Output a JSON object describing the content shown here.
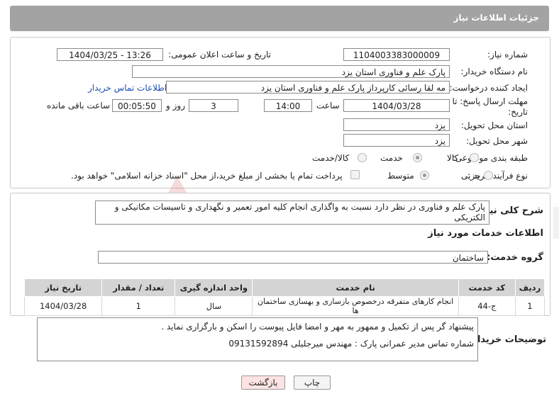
{
  "header": {
    "title": "جزئیات اطلاعات نیاز"
  },
  "form": {
    "need_number_label": "شماره نیاز:",
    "need_number": "1104003383000009",
    "announce_label": "تاریخ و ساعت اعلان عمومی:",
    "announce_value": "1404/03/25 - 13:26",
    "buyer_label": "نام دستگاه خریدار:",
    "buyer_value": "پارک علم و فناوری استان یزد",
    "creator_label": "ایجاد کننده درخواست:",
    "creator_value": "مه لقا رسائی  کارپرداز پارک علم و فناوری استان یزد",
    "contact_link": "اطلاعات تماس خریدار",
    "deadline_label": "مهلت ارسال پاسخ: تا تاریخ:",
    "deadline_date": "1404/03/28",
    "hour_label": "ساعت",
    "deadline_time": "14:00",
    "days_value": "3",
    "days_label": "روز و",
    "remaining_value": "00:05:50",
    "remaining_label": "ساعت باقی مانده",
    "province_label": "استان محل تحویل:",
    "province_value": "یزد",
    "city_label": "شهر محل تحویل:",
    "city_value": "یزد",
    "category_label": "طبقه بندی موضوعی:",
    "category_options": [
      "کالا",
      "خدمت",
      "کالا/خدمت"
    ],
    "category_selected": "خدمت",
    "process_label": "نوع فرآیند خرید :",
    "process_options": [
      "جزیی",
      "متوسط"
    ],
    "process_selected": "متوسط",
    "payment_text": "پرداخت تمام یا بخشی از مبلغ خرید،از محل \"اسناد خزانه اسلامی\" خواهد بود."
  },
  "summary": {
    "label": "شرح کلی نیاز:",
    "text": "پارک علم و فناوری در نظر دارد نسبت به واگذاری انجام کلیه امور تعمیر و نگهداری و تاسیسات مکانیکی و الکتریکی"
  },
  "services": {
    "section_title": "اطلاعات خدمات مورد نیاز",
    "group_label": "گروه خدمت:",
    "group_value": "ساختمان",
    "columns": [
      "ردیف",
      "کد خدمت",
      "نام خدمت",
      "واحد اندازه گیری",
      "تعداد / مقدار",
      "تاریخ نیاز"
    ],
    "rows": [
      {
        "row": "1",
        "code": "ج-44",
        "name": "انجام کارهای متفرقه درخصوص بازسازی و بهسازی ساختمان ها",
        "unit": "سال",
        "qty": "1",
        "date": "1404/03/28"
      }
    ]
  },
  "notes": {
    "label": "توضیحات خریدار:",
    "line1": "پیشنهاد گر پس از تکمیل و ممهور به مهر و امضا فایل پیوست را اسکن و بارگزاری نماید .",
    "line2": "شماره تماس مدیر عمرانی پارک : مهندس میرجلیلی 09131592894"
  },
  "buttons": {
    "print": "چاپ",
    "back": "بازگشت"
  },
  "watermark": {
    "text": "AriaTender.neT"
  },
  "colors": {
    "header_bg": "#a3a3a3",
    "link": "#1a4fb5",
    "back_bg": "#fde3e3",
    "watermark": "#c62828"
  }
}
